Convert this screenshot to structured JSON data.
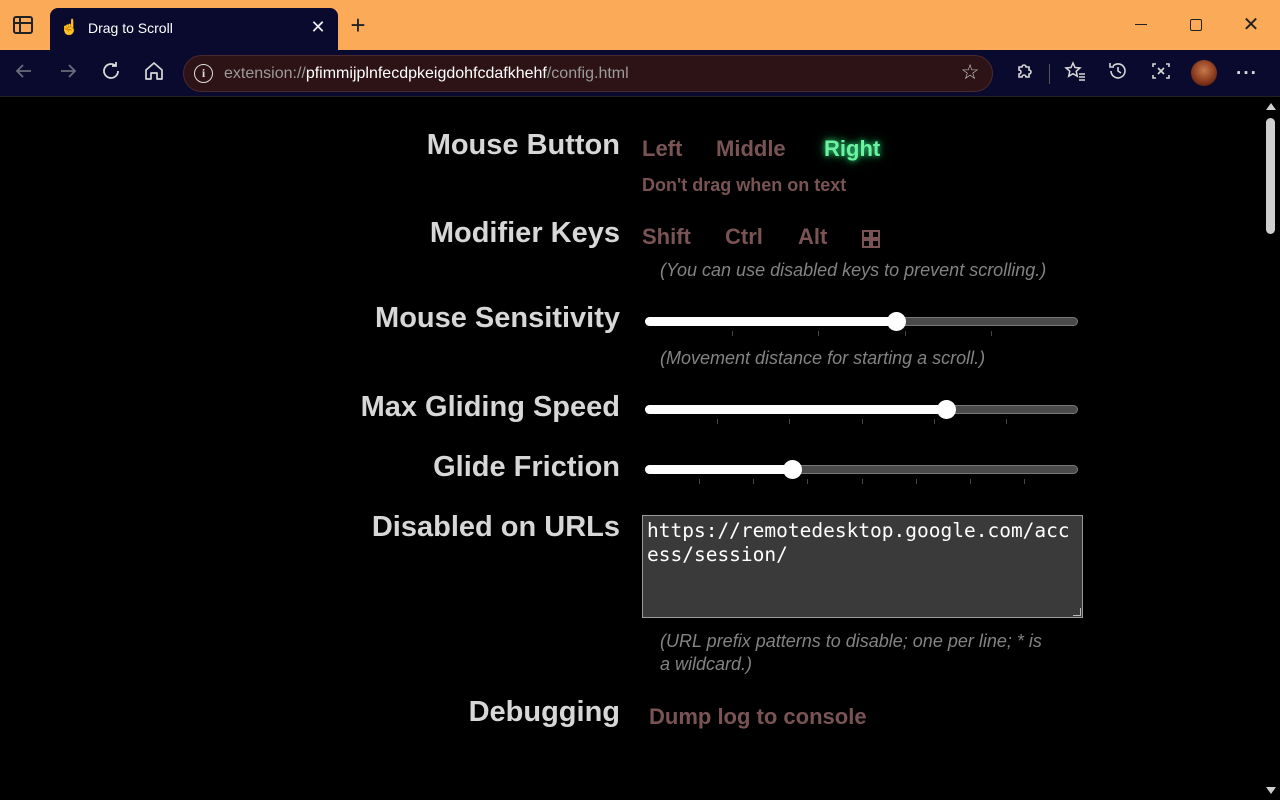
{
  "browser": {
    "tab_title": "Drag to Scroll",
    "tab_close": "✕",
    "new_tab": "+",
    "address_prefix": "extension://",
    "address_host": "pfimmijplnfecdpkeigdohfcdafkhehf",
    "address_path": "/config.html",
    "window": {
      "close": "✕"
    }
  },
  "settings": {
    "mouse_button": {
      "label": "Mouse Button",
      "options": [
        "Left",
        "Middle",
        "Right"
      ],
      "selected": "Right",
      "dont_drag_text": "Don't drag when on text"
    },
    "modifier_keys": {
      "label": "Modifier Keys",
      "options": [
        "Shift",
        "Ctrl",
        "Alt"
      ],
      "hint": "(You can use disabled keys to prevent scrolling.)"
    },
    "mouse_sensitivity": {
      "label": "Mouse Sensitivity",
      "value": 0.58,
      "hint": "(Movement distance for starting a scroll.)"
    },
    "max_gliding_speed": {
      "label": "Max Gliding Speed",
      "value": 0.694
    },
    "glide_friction": {
      "label": "Glide Friction",
      "value": 0.34
    },
    "disabled_urls": {
      "label": "Disabled on URLs",
      "value": "https://remotedesktop.google.com/access/session/",
      "hint_line1": "(URL prefix patterns to disable; one per line; * is",
      "hint_line2": "a wildcard.)"
    },
    "debugging": {
      "label": "Debugging",
      "action": "Dump log to console"
    }
  },
  "colors": {
    "accent_active": "#6cf2a0",
    "option_inactive": "#7a5454",
    "titlebar": "#fbaa58",
    "toolbar": "#0a0a2e"
  }
}
